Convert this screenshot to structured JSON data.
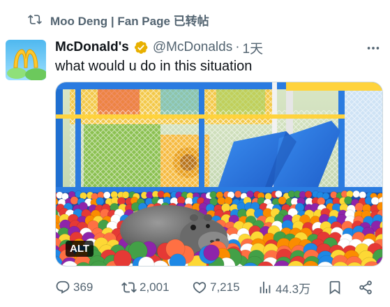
{
  "repost": {
    "icon": "repost-icon",
    "text": "Moo Deng | Fan Page 已转帖"
  },
  "tweet": {
    "display_name": "McDonald's",
    "verified_icon": "verified-badge-icon",
    "handle": "@McDonalds",
    "separator": "·",
    "time": "1天",
    "text": "what would u do in this situation",
    "media": {
      "alt_label": "ALT"
    }
  },
  "actions": {
    "replies": "369",
    "reposts": "2,001",
    "likes": "7,215",
    "views": "44.3万"
  },
  "colors": {
    "secondary_text": "#536471",
    "verified": "#f4b400",
    "brand_red": "#da291c",
    "brand_yellow": "#ffc72c"
  }
}
